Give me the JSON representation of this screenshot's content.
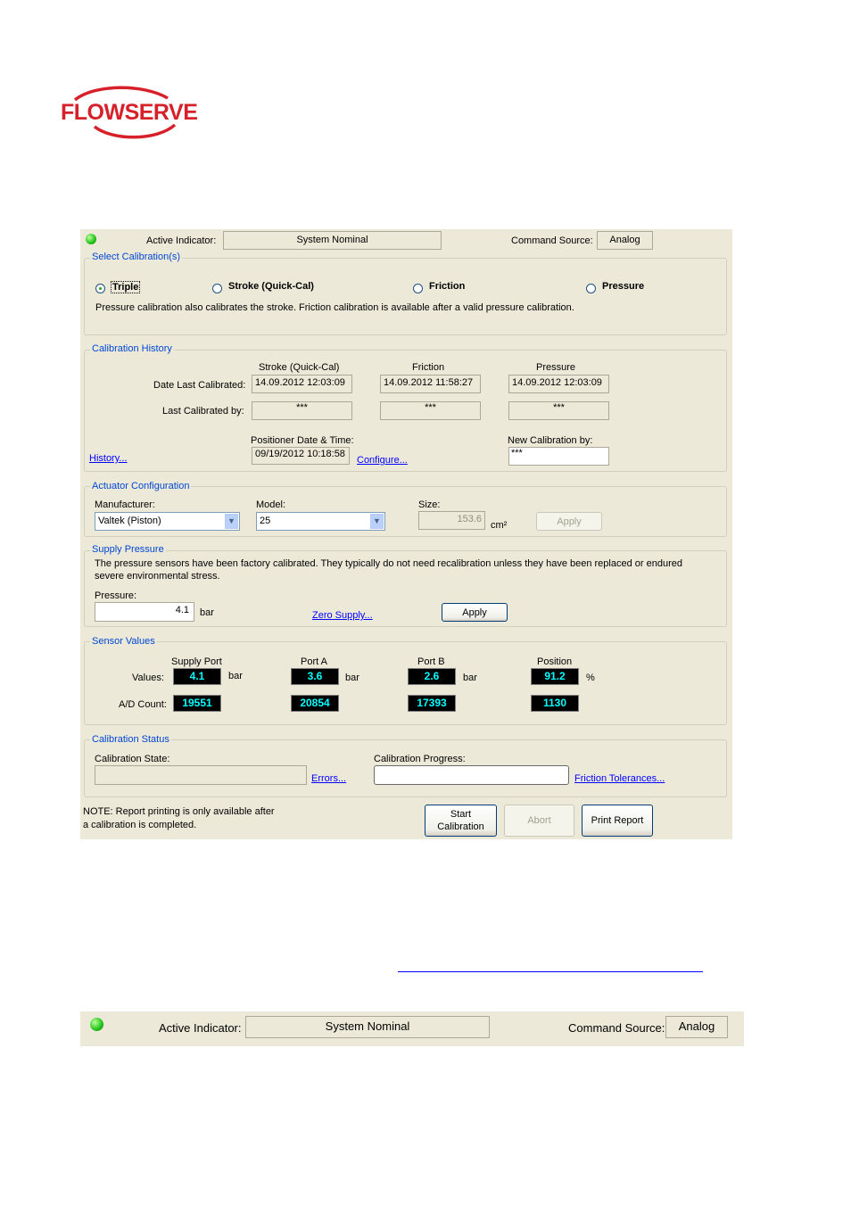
{
  "brand": {
    "logo_text": "FLOWSERVE",
    "logo_color": "#d7212a"
  },
  "header": {
    "active_indicator_label": "Active Indicator:",
    "active_indicator_value": "System Nominal",
    "command_source_label": "Command Source:",
    "command_source_value": "Analog"
  },
  "select_calibration": {
    "title": "Select Calibration(s)",
    "options": [
      {
        "label": "Triple",
        "checked": true
      },
      {
        "label": "Stroke (Quick-Cal)",
        "checked": false
      },
      {
        "label": "Friction",
        "checked": false
      },
      {
        "label": "Pressure",
        "checked": false
      }
    ],
    "note": "Pressure calibration also calibrates the stroke.  Friction calibration is available after a valid pressure calibration."
  },
  "calibration_history": {
    "title": "Calibration History",
    "col_stroke": "Stroke (Quick-Cal)",
    "col_friction": "Friction",
    "col_pressure": "Pressure",
    "date_label": "Date Last Calibrated:",
    "date_stroke": "14.09.2012 12:03:09",
    "date_friction": "14.09.2012 11:58:27",
    "date_pressure": "14.09.2012 12:03:09",
    "by_label": "Last Calibrated by:",
    "by_stroke": "***",
    "by_friction": "***",
    "by_pressure": "***",
    "positioner_dt_label": "Positioner Date & Time:",
    "positioner_dt_value": "09/19/2012 10:18:58",
    "new_cal_label": "New Calibration by:",
    "new_cal_value": "***",
    "history_link": "History...",
    "configure_link": "Configure..."
  },
  "actuator": {
    "title": "Actuator Configuration",
    "manufacturer_label": "Manufacturer:",
    "manufacturer_value": "Valtek (Piston)",
    "model_label": "Model:",
    "model_value": "25",
    "size_label": "Size:",
    "size_value": "153.6",
    "size_unit": "cm²",
    "apply_label": "Apply"
  },
  "supply": {
    "title": "Supply Pressure",
    "note_line1": "The pressure sensors have been factory calibrated.  They typically do not need recalibration unless they have been replaced or endured",
    "note_line2": "severe environmental stress.",
    "pressure_label": "Pressure:",
    "pressure_value": "4.1",
    "pressure_unit": "bar",
    "zero_link": "Zero Supply...",
    "apply_label": "Apply"
  },
  "sensors": {
    "title": "Sensor Values",
    "values_label": "Values:",
    "ad_label": "A/D Count:",
    "columns": [
      {
        "name": "Supply Port",
        "value": "4.1",
        "unit": "bar",
        "ad": "19551"
      },
      {
        "name": "Port A",
        "value": "3.6",
        "unit": "bar",
        "ad": "20854"
      },
      {
        "name": "Port B",
        "value": "2.6",
        "unit": "bar",
        "ad": "17393"
      },
      {
        "name": "Position",
        "value": "91.2",
        "unit": "%",
        "ad": "1130"
      }
    ]
  },
  "status": {
    "title": "Calibration Status",
    "state_label": "Calibration State:",
    "state_value": "",
    "errors_link": "Errors...",
    "progress_label": "Calibration Progress:",
    "progress_fraction": 0,
    "tolerances_link": "Friction Tolerances..."
  },
  "footer": {
    "note_line1": "NOTE: Report printing is only available after",
    "note_line2": "a calibration is completed.",
    "start_line1": "Start",
    "start_line2": "Calibration",
    "abort_label": "Abort",
    "print_label": "Print Report"
  },
  "strip": {
    "active_indicator_label": "Active Indicator:",
    "active_indicator_value": "System Nominal",
    "command_source_label": "Command Source:",
    "command_source_value": "Analog"
  }
}
